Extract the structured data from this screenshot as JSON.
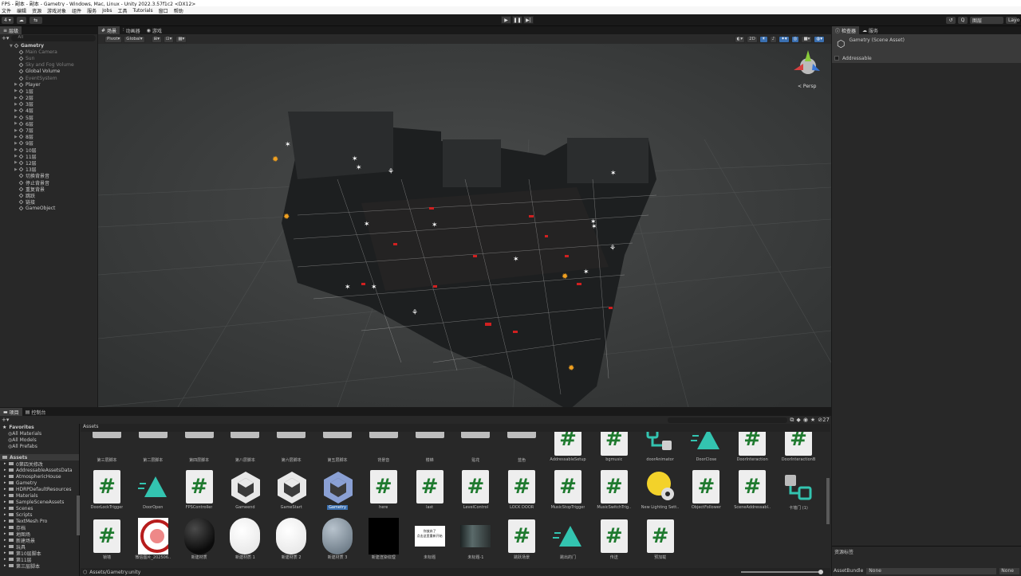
{
  "window": {
    "title": "FPS - 副本 - 副本 - Gametry - Windows, Mac, Linux - Unity 2022.3.57f1c2 <DX12>"
  },
  "menu": [
    "文件",
    "编辑",
    "资源",
    "游戏对象",
    "组件",
    "服务",
    "Jobs",
    "工具",
    "Tutorials",
    "窗口",
    "帮助"
  ],
  "toolbar": {
    "account": "4 ▾",
    "search_label": "Q",
    "layers": "图层",
    "layout": "Layo"
  },
  "hierarchy": {
    "tab": "层级",
    "search": "All",
    "scene": "Gametry",
    "items": [
      {
        "label": "Main Camera",
        "dim": true,
        "arrow": ""
      },
      {
        "label": "Sun",
        "dim": true,
        "arrow": ""
      },
      {
        "label": "Sky and Fog Volume",
        "dim": true,
        "arrow": ""
      },
      {
        "label": "Global Volume",
        "dim": false,
        "arrow": ""
      },
      {
        "label": "EventSystem",
        "dim": true,
        "arrow": ""
      },
      {
        "label": "Player",
        "dim": false,
        "arrow": "▶"
      },
      {
        "label": "1层",
        "dim": false,
        "arrow": "▶"
      },
      {
        "label": "2层",
        "dim": false,
        "arrow": "▶"
      },
      {
        "label": "3层",
        "dim": false,
        "arrow": "▶"
      },
      {
        "label": "4层",
        "dim": false,
        "arrow": "▶"
      },
      {
        "label": "5层",
        "dim": false,
        "arrow": "▶"
      },
      {
        "label": "6层",
        "dim": false,
        "arrow": "▶"
      },
      {
        "label": "7层",
        "dim": false,
        "arrow": "▶"
      },
      {
        "label": "8层",
        "dim": false,
        "arrow": "▶"
      },
      {
        "label": "9层",
        "dim": false,
        "arrow": "▶"
      },
      {
        "label": "10层",
        "dim": false,
        "arrow": "▶"
      },
      {
        "label": "11层",
        "dim": false,
        "arrow": "▶"
      },
      {
        "label": "12层",
        "dim": false,
        "arrow": "▶"
      },
      {
        "label": "13层",
        "dim": false,
        "arrow": "▶"
      },
      {
        "label": "切换背景音",
        "dim": false,
        "arrow": ""
      },
      {
        "label": "停止背景音",
        "dim": false,
        "arrow": ""
      },
      {
        "label": "重复背景",
        "dim": false,
        "arrow": ""
      },
      {
        "label": "跳跃",
        "dim": false,
        "arrow": ""
      },
      {
        "label": "链接",
        "dim": false,
        "arrow": ""
      },
      {
        "label": "GameObject",
        "dim": false,
        "arrow": ""
      }
    ]
  },
  "scene_view": {
    "tabs": [
      "场景",
      "动画器",
      "游戏"
    ],
    "tools_left": [
      "Pivot",
      "Global"
    ],
    "btn_2d": "2D",
    "persp": "< Persp",
    "gizmo_axes": {
      "y": "y",
      "x": "x",
      "z": "z"
    }
  },
  "inspector": {
    "tabs": [
      "检查器",
      "服务"
    ],
    "title": "Gametry (Scene Asset)",
    "addressable": "Addressable",
    "bottom_label": "资源标签",
    "assetbundle_label": "AssetBundle",
    "assetbundle_value": "None",
    "assetbundle_variant": "None"
  },
  "project": {
    "tabs": [
      "项目",
      "控制台"
    ],
    "favorites": "Favorites",
    "fav_items": [
      "All Materials",
      "All Models",
      "All Prefabs"
    ],
    "assets_root": "Assets",
    "tree": [
      "0第四关修改",
      "AddressableAssetsData",
      "AtmosphericHouse",
      "Gametry",
      "HDRPDefaultResources",
      "Materials",
      "SampleSceneAssets",
      "Scenes",
      "Scripts",
      "TextMesh Pro",
      "存档",
      "地图场",
      "新建场景",
      "玩具",
      "第10层脚本",
      "第11层",
      "第三层脚本"
    ],
    "breadcrumb": "Assets",
    "path": "Assets/Gametry.unity",
    "icon_count": "27",
    "row1": [
      {
        "label": "第三层脚本",
        "kind": "folder"
      },
      {
        "label": "第二层脚本",
        "kind": "folder"
      },
      {
        "label": "第四层脚本",
        "kind": "folder"
      },
      {
        "label": "第八层脚本",
        "kind": "folder"
      },
      {
        "label": "第六层脚本",
        "kind": "folder"
      },
      {
        "label": "第五层脚本",
        "kind": "folder"
      },
      {
        "label": "背景音",
        "kind": "folder"
      },
      {
        "label": "楼梯",
        "kind": "folder"
      },
      {
        "label": "贴花",
        "kind": "folder"
      },
      {
        "label": "蓝色",
        "kind": "folder"
      },
      {
        "label": "AddressableSetup",
        "kind": "script"
      },
      {
        "label": "bgmusic",
        "kind": "script"
      },
      {
        "label": "doorAnimator",
        "kind": "anim"
      },
      {
        "label": "DoorClose",
        "kind": "tri"
      },
      {
        "label": "DoorInteraction",
        "kind": "script"
      },
      {
        "label": "DoorInteractionB",
        "kind": "script"
      }
    ],
    "row2": [
      {
        "label": "DoorLockTrigger",
        "kind": "script"
      },
      {
        "label": "DoorOpen",
        "kind": "tri"
      },
      {
        "label": "FPSController",
        "kind": "script"
      },
      {
        "label": "Gameend",
        "kind": "unity"
      },
      {
        "label": "GameStart",
        "kind": "unity"
      },
      {
        "label": "Gametry",
        "kind": "unity-sel"
      },
      {
        "label": "here",
        "kind": "script"
      },
      {
        "label": "last",
        "kind": "script"
      },
      {
        "label": "LevelControl",
        "kind": "script"
      },
      {
        "label": "LOCK DOOR",
        "kind": "script"
      },
      {
        "label": "MusicStopTrigger",
        "kind": "script"
      },
      {
        "label": "MusicSwitchTrig..",
        "kind": "script"
      },
      {
        "label": "New Lighting Sett..",
        "kind": "light"
      },
      {
        "label": "ObjectFollower",
        "kind": "script"
      },
      {
        "label": "SceneAddressabl..",
        "kind": "script"
      },
      {
        "label": "卡墙门 (1)",
        "kind": "prefab"
      }
    ],
    "row3": [
      {
        "label": "锁墙",
        "kind": "script"
      },
      {
        "label": "微信图片_202506..",
        "kind": "img"
      },
      {
        "label": "新建材质",
        "kind": "sphere-dark"
      },
      {
        "label": "新建材质 1",
        "kind": "sphere-white"
      },
      {
        "label": "新建材质 2",
        "kind": "sphere-white"
      },
      {
        "label": "新建材质 3",
        "kind": "sphere-grey"
      },
      {
        "label": "新建渲染纹理",
        "kind": "black"
      },
      {
        "label": "未标题",
        "kind": "card"
      },
      {
        "label": "未标题-1",
        "kind": "photo"
      },
      {
        "label": "跳跃场景",
        "kind": "script"
      },
      {
        "label": "跳出的门",
        "kind": "tri"
      },
      {
        "label": "传送",
        "kind": "script"
      },
      {
        "label": "预加载",
        "kind": "script"
      }
    ],
    "card_text": "你放弃了\n点击这里重新开始"
  },
  "colors": {
    "accent": "#3a6fb0",
    "script_green": "#1f7a2f",
    "bg": "#191919",
    "panel": "#282828"
  }
}
